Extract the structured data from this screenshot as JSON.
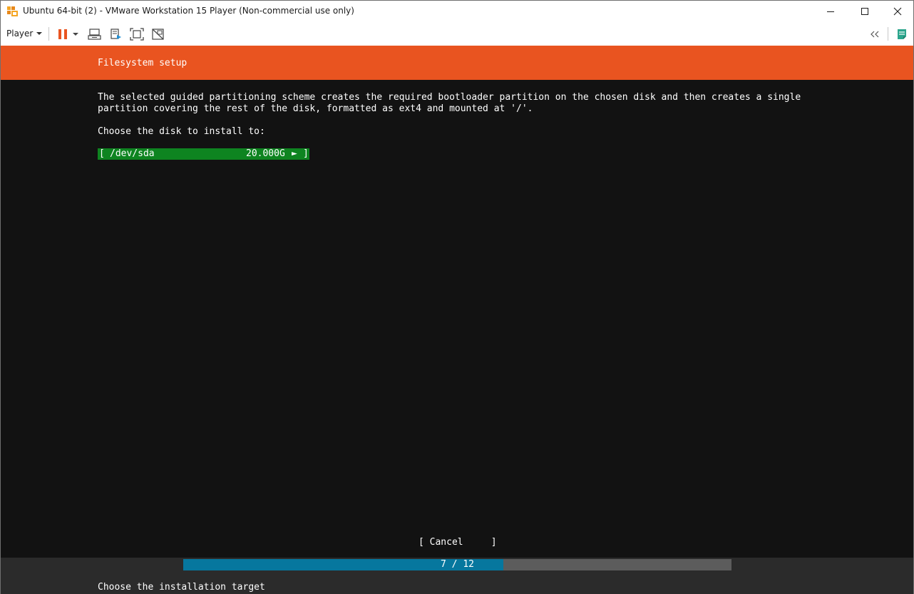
{
  "window": {
    "title": "Ubuntu 64-bit (2) - VMware Workstation 15 Player (Non-commercial use only)"
  },
  "toolbar": {
    "player_menu_label": "Player",
    "icons": [
      "pause-icon",
      "dropdown-arrow-icon",
      "send-ctrl-alt-del-icon",
      "removable-devices-icon",
      "full-screen-icon",
      "unity-icon",
      "collapse-toolbar-icon",
      "library-icon"
    ]
  },
  "installer": {
    "header_title": "Filesystem setup",
    "description_line1": "The selected guided partitioning scheme creates the required bootloader partition on the chosen disk and then creates a single",
    "description_line2": "partition covering the rest of the disk, formatted as ext4 and mounted at '/'.",
    "choose_prompt": "Choose the disk to install to:",
    "disk": {
      "open_bracket": "[",
      "name": "/dev/sda",
      "size": "20.000G",
      "arrow": "►",
      "close_bracket": "]"
    },
    "cancel_label": "[ Cancel     ]",
    "progress": {
      "label": "7 / 12",
      "current": 7,
      "total": 12
    },
    "footer_hint": "Choose the installation target"
  },
  "colors": {
    "ubuntu_orange": "#e95420",
    "selection_green": "#0e8420",
    "progress_blue": "#06779e",
    "terminal_bg": "#121212",
    "pause_icon": "#e95420",
    "library_icon": "#2ba58c"
  }
}
